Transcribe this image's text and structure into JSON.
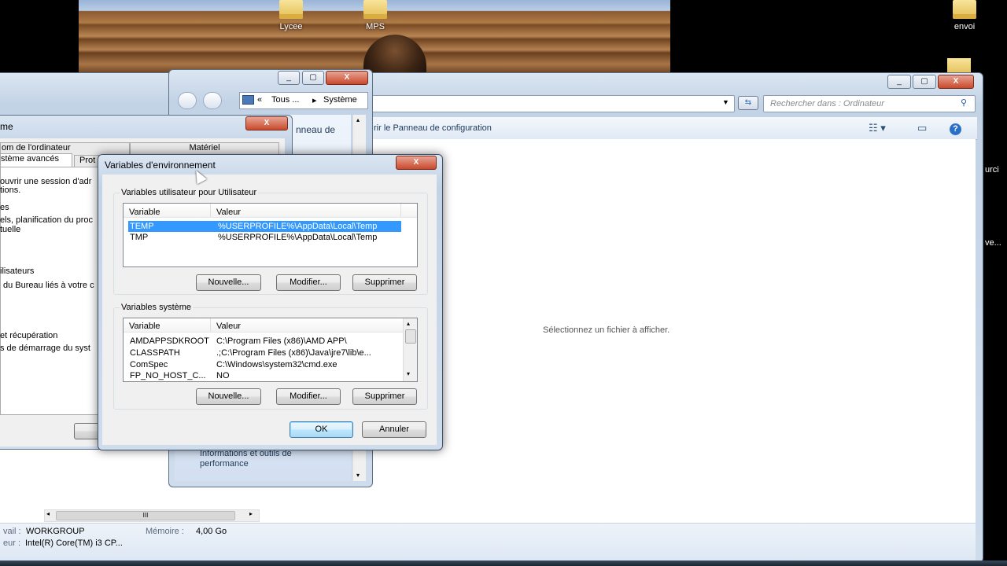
{
  "desktop": {
    "icons": [
      {
        "label": "Lycee"
      },
      {
        "label": "MPS"
      },
      {
        "label": "envoi"
      }
    ],
    "partial_labels": [
      "urci",
      "ve..."
    ]
  },
  "explorer": {
    "address_sep": "«",
    "breadcrumb_1": "Tous ...",
    "breadcrumb_arrow": "▸",
    "breadcrumb_2": "Système",
    "search_placeholder": "Rechercher dans : Ordinateur",
    "command_text": "rir le Panneau de configuration",
    "preview_text": "Sélectionnez un fichier à afficher.",
    "details": {
      "workgroup_label": "vail :",
      "workgroup_value": "WORKGROUP",
      "memory_label": "Mémoire :",
      "memory_value": "4,00 Go",
      "processor_label": "eur :",
      "processor_value": "Intel(R) Core(TM) i3 CP..."
    },
    "hscroll_grip": "III"
  },
  "system_window": {
    "snippet": "nneau de",
    "perf_link": "Informations et outils de performance"
  },
  "sysprops": {
    "title_fragment": "me",
    "tabs": [
      {
        "label": "om de l'ordinateur"
      },
      {
        "label": "Matériel"
      },
      {
        "label": "stème avancés"
      },
      {
        "label": "Prot"
      }
    ],
    "fragments": [
      "ouvrir une session d'adr",
      "tions.",
      "es",
      "els, planification du proc",
      "tuelle",
      "ilisateurs",
      "du Bureau liés à votre c",
      "et récupération",
      "s de démarrage du syst"
    ]
  },
  "env_dialog": {
    "title": "Variables d'environnement",
    "close_glyph": "X",
    "user_group_label": "Variables utilisateur pour Utilisateur",
    "system_group_label": "Variables système",
    "col_variable": "Variable",
    "col_value": "Valeur",
    "user_vars": [
      {
        "name": "TEMP",
        "value": "%USERPROFILE%\\AppData\\Local\\Temp",
        "selected": true
      },
      {
        "name": "TMP",
        "value": "%USERPROFILE%\\AppData\\Local\\Temp",
        "selected": false
      }
    ],
    "system_vars": [
      {
        "name": "AMDAPPSDKROOT",
        "value": "C:\\Program Files (x86)\\AMD APP\\"
      },
      {
        "name": "CLASSPATH",
        "value": ".;C:\\Program Files (x86)\\Java\\jre7\\lib\\e..."
      },
      {
        "name": "ComSpec",
        "value": "C:\\Windows\\system32\\cmd.exe"
      },
      {
        "name": "FP_NO_HOST_C...",
        "value": "NO"
      }
    ],
    "buttons": {
      "new": "Nouvelle...",
      "edit": "Modifier...",
      "delete": "Supprimer",
      "ok": "OK",
      "cancel": "Annuler"
    }
  }
}
